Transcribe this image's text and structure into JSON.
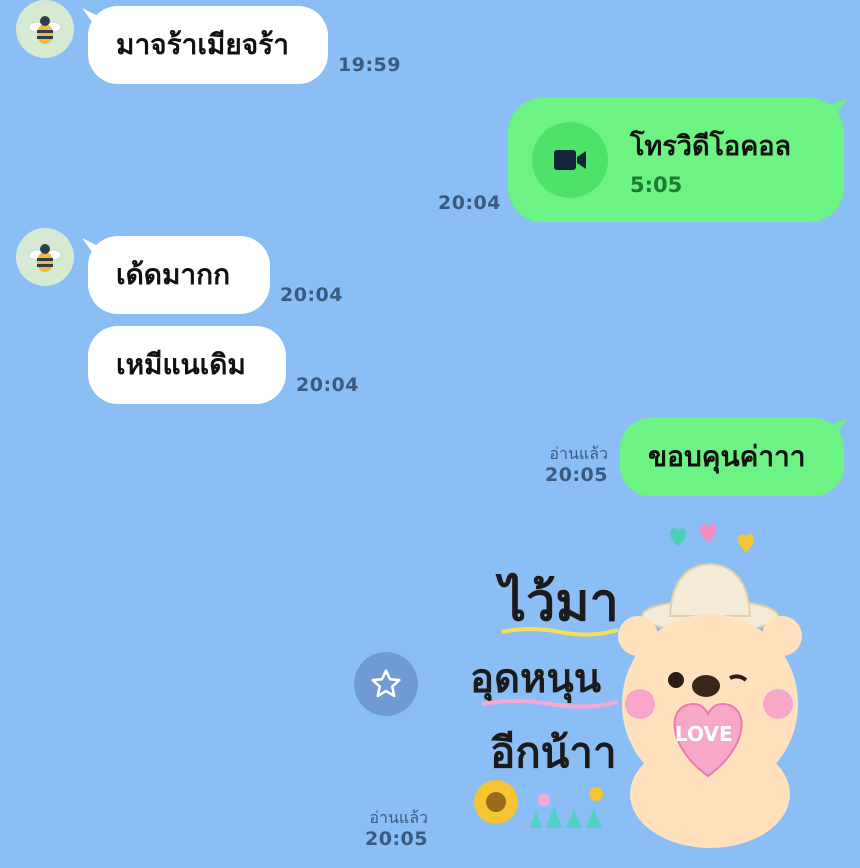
{
  "colors": {
    "background": "#8bbef5",
    "incoming_bubble": "#ffffff",
    "outgoing_bubble": "#6cf383",
    "call_duration": "#1b7d33",
    "timestamp": "#3c5a80"
  },
  "messages": [
    {
      "id": "m1",
      "direction": "incoming",
      "text": "มาจร้าเมียจร้า",
      "time": "19:59"
    },
    {
      "id": "m2",
      "direction": "outgoing",
      "type": "video-call",
      "title": "โทรวิดีโอคอล",
      "duration": "5:05",
      "time": "20:04",
      "icon": "video-camera-icon"
    },
    {
      "id": "m3",
      "direction": "incoming",
      "text": "เด้ดมากก",
      "time": "20:04"
    },
    {
      "id": "m4",
      "direction": "incoming",
      "text": "เหมีแนเดิม",
      "time": "20:04"
    },
    {
      "id": "m5",
      "direction": "outgoing",
      "text": "ขอบคุนค่าาา",
      "read": "อ่านแล้ว",
      "time": "20:05"
    },
    {
      "id": "m6",
      "direction": "outgoing",
      "type": "sticker",
      "read": "อ่านแล้ว",
      "time": "20:05",
      "sticker_lines": [
        "ไว้มา",
        "อุดหนุน",
        "อีกน้าา"
      ],
      "sticker_badge": "LOVE"
    }
  ],
  "sticker_action": {
    "icon": "star-icon"
  }
}
